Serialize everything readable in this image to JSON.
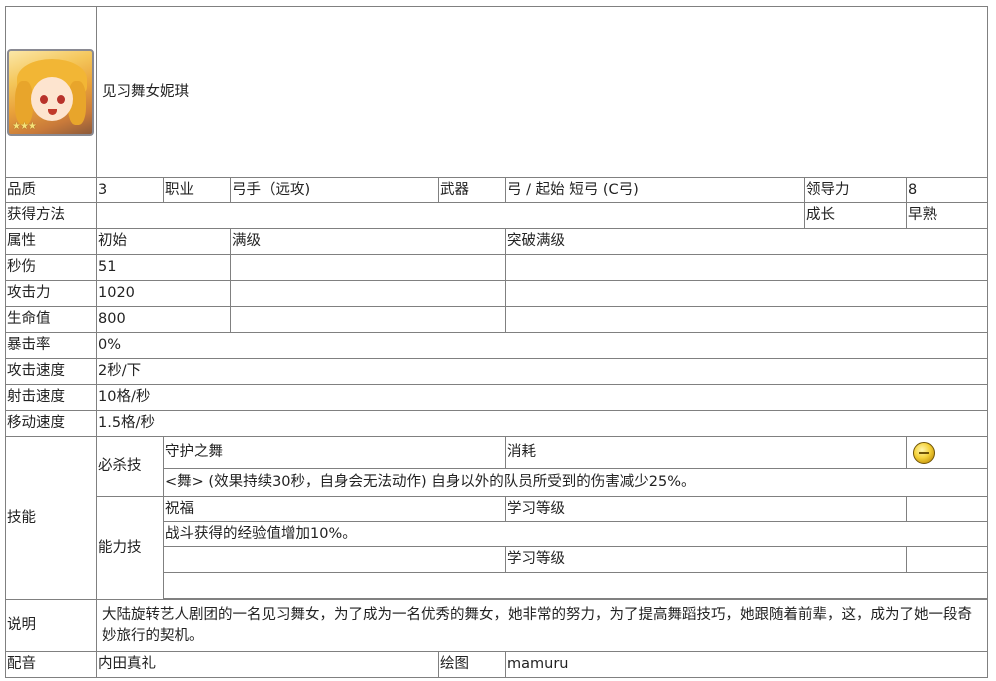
{
  "character": {
    "name": "见习舞女妮琪",
    "portrait_icon": "character-portrait-icon",
    "rarity_icon": "star-rating-icon"
  },
  "row_quality": {
    "quality_label": "品质",
    "quality_value": "3",
    "class_label": "职业",
    "class_value": "弓手（远攻)",
    "weapon_label": "武器",
    "weapon_value": "弓 / 起始 短弓 (C弓)",
    "leadership_label": "领导力",
    "leadership_value": "8"
  },
  "row_obtain": {
    "obtain_label": "获得方法",
    "obtain_value": "",
    "growth_label": "成长",
    "growth_value": "早熟"
  },
  "attributes": {
    "header": {
      "attr": "属性",
      "initial": "初始",
      "max": "满级",
      "breakthrough": "突破满级"
    },
    "rows": [
      {
        "label": "秒伤",
        "initial": "51",
        "max": "",
        "breakthrough": ""
      },
      {
        "label": "攻击力",
        "initial": "1020",
        "max": "",
        "breakthrough": ""
      },
      {
        "label": "生命值",
        "initial": "800",
        "max": "",
        "breakthrough": ""
      }
    ],
    "simple_rows": [
      {
        "label": "暴击率",
        "value": "0%"
      },
      {
        "label": "攻击速度",
        "value": "2秒/下"
      },
      {
        "label": "射击速度",
        "value": "10格/秒"
      },
      {
        "label": "移动速度",
        "value": "1.5格/秒"
      }
    ]
  },
  "skills": {
    "label": "技能",
    "special": {
      "label": "必杀技",
      "name": "守护之舞",
      "cost_label": "消耗",
      "cost_icon": "gold-coin-icon",
      "description": "<舞> (效果持续30秒，自身会无法动作) 自身以外的队员所受到的伤害减少25%。"
    },
    "ability": {
      "label": "能力技",
      "name": "祝福",
      "learn_label": "学习等级",
      "learn_value": "",
      "description": "战斗获得的经验值增加10%。",
      "name2": "",
      "learn_label2": "学习等级",
      "learn_value2": "",
      "description2": ""
    }
  },
  "description": {
    "label": "说明",
    "text": "大陆旋转艺人剧团的一名见习舞女，为了成为一名优秀的舞女，她非常的努力，为了提高舞蹈技巧，她跟随着前辈，这，成为了她一段奇妙旅行的契机。"
  },
  "credits": {
    "voice_label": "配音",
    "voice_value": "内田真礼",
    "art_label": "绘图",
    "art_value": "mamuru"
  }
}
